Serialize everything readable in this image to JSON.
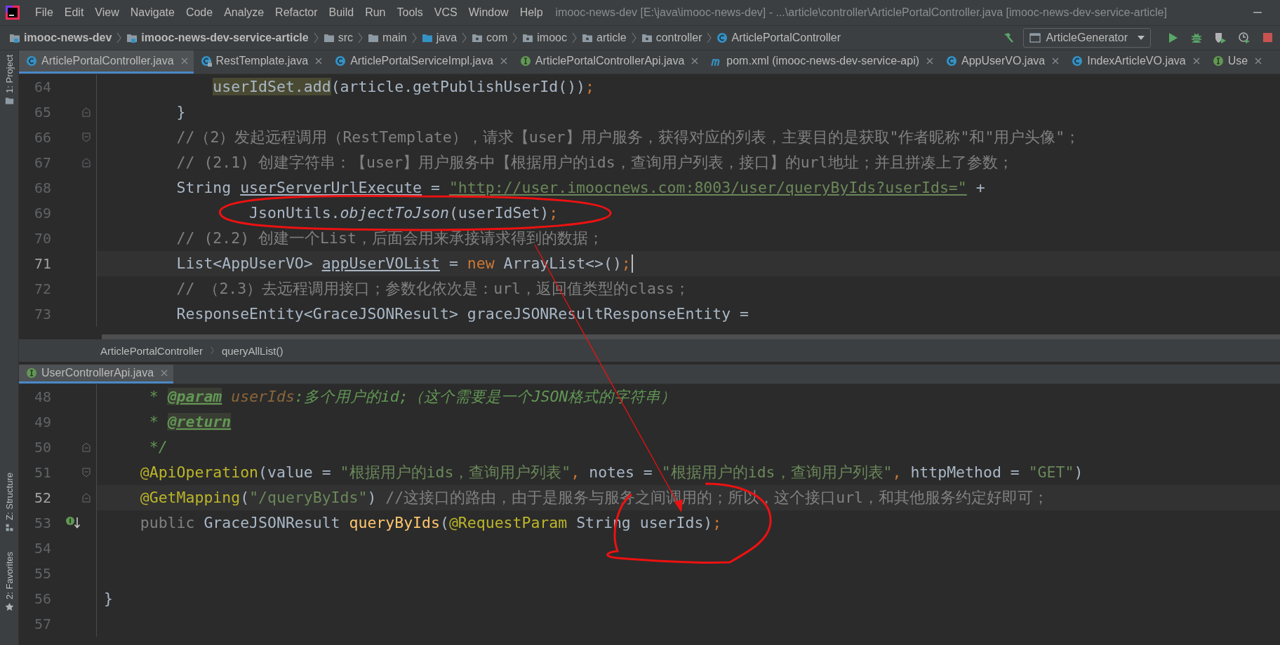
{
  "menu_bar": {
    "items": [
      "File",
      "Edit",
      "View",
      "Navigate",
      "Code",
      "Analyze",
      "Refactor",
      "Build",
      "Run",
      "Tools",
      "VCS",
      "Window",
      "Help"
    ],
    "title": "imooc-news-dev [E:\\java\\imooc-news-dev] - ...\\article\\controller\\ArticlePortalController.java [imooc-news-dev-service-article]"
  },
  "nav_bar": {
    "crumbs": [
      {
        "label": "imooc-news-dev",
        "kind": "module"
      },
      {
        "label": "imooc-news-dev-service-article",
        "kind": "module"
      },
      {
        "label": "src",
        "kind": "folder"
      },
      {
        "label": "main",
        "kind": "folder"
      },
      {
        "label": "java",
        "kind": "source"
      },
      {
        "label": "com",
        "kind": "package"
      },
      {
        "label": "imooc",
        "kind": "package"
      },
      {
        "label": "article",
        "kind": "package"
      },
      {
        "label": "controller",
        "kind": "package"
      },
      {
        "label": "ArticlePortalController",
        "kind": "class"
      }
    ],
    "run_config": "ArticleGenerator"
  },
  "side_strip": [
    {
      "label": "1: Project",
      "kind": "project"
    },
    {
      "label": "Z: Structure",
      "kind": "structure"
    },
    {
      "label": "2: Favorites",
      "kind": "favorites"
    }
  ],
  "editor_tabs": [
    {
      "label": "ArticlePortalController.java",
      "kind": "class",
      "selected": true,
      "locked": false
    },
    {
      "label": "RestTemplate.java",
      "kind": "class",
      "selected": false,
      "locked": true
    },
    {
      "label": "ArticlePortalServiceImpl.java",
      "kind": "class",
      "selected": false,
      "locked": false
    },
    {
      "label": "ArticlePortalControllerApi.java",
      "kind": "interface",
      "selected": false,
      "locked": false
    },
    {
      "label": "pom.xml (imooc-news-dev-service-api)",
      "kind": "maven",
      "selected": false,
      "locked": false
    },
    {
      "label": "AppUserVO.java",
      "kind": "class",
      "selected": false,
      "locked": false
    },
    {
      "label": "IndexArticleVO.java",
      "kind": "class",
      "selected": false,
      "locked": false
    },
    {
      "label": "Use",
      "kind": "interface",
      "selected": false,
      "locked": false
    }
  ],
  "top_editor": {
    "lines": [
      {
        "number": "64",
        "tokens": [
          {
            "text": "            userIdSet.add",
            "kind": "usage"
          },
          {
            "text": "(article.getPublishUserId())",
            "kind": "plain"
          },
          {
            "text": ";",
            "kind": "keyword"
          }
        ]
      },
      {
        "number": "65",
        "fold_close": true,
        "tokens": [
          {
            "text": "        }",
            "kind": "plain"
          }
        ]
      },
      {
        "number": "66",
        "fold_open": true,
        "tokens": [
          {
            "text": "        //（2）发起远程调用（RestTemplate），请求【user】用户服务，获得对应的列表，主要目的是获取\"作者昵称\"和\"用户头像\"；",
            "kind": "comment"
          }
        ]
      },
      {
        "number": "67",
        "fold_close": true,
        "tokens": [
          {
            "text": "        // (2.1) 创建字符串：【user】用户服务中【根据用户的ids，查询用户列表，接口】的url地址；并且拼凑上了参数；",
            "kind": "comment"
          }
        ]
      },
      {
        "number": "68",
        "tokens": [
          {
            "text": "        String ",
            "kind": "plain"
          },
          {
            "text": "userServerUrlExecute",
            "kind": "underlined"
          },
          {
            "text": " = ",
            "kind": "plain"
          },
          {
            "text": "\"http://user.imoocnews.com:8003/user/queryByIds?userIds=\"",
            "kind": "link"
          },
          {
            "text": " +",
            "kind": "plain"
          }
        ]
      },
      {
        "number": "69",
        "tokens": [
          {
            "text": "                JsonUtils.",
            "kind": "plain"
          },
          {
            "text": "objectToJson",
            "kind": "static"
          },
          {
            "text": "(userIdSet)",
            "kind": "plain"
          },
          {
            "text": ";",
            "kind": "keyword"
          }
        ]
      },
      {
        "number": "70",
        "tokens": [
          {
            "text": "        // (2.2) 创建一个List，后面会用来承接请求得到的数据；",
            "kind": "comment"
          }
        ]
      },
      {
        "number": "71",
        "current": true,
        "caret": true,
        "tokens": [
          {
            "text": "        List<AppUserVO> ",
            "kind": "plain"
          },
          {
            "text": "appUserVOList",
            "kind": "underlined"
          },
          {
            "text": " = ",
            "kind": "plain"
          },
          {
            "text": "new",
            "kind": "keyword"
          },
          {
            "text": " ArrayList<>()",
            "kind": "plain"
          },
          {
            "text": ";",
            "kind": "keyword"
          }
        ]
      },
      {
        "number": "72",
        "tokens": [
          {
            "text": "        // （2.3）去远程调用接口；参数化依次是：url，返回值类型的class；",
            "kind": "comment"
          }
        ]
      },
      {
        "number": "73",
        "tokens": [
          {
            "text": "        ResponseEntity<GraceJSONResult> graceJSONResultResponseEntity =",
            "kind": "plain"
          }
        ]
      }
    ],
    "breadcrumbs": [
      "ArticlePortalController",
      "queryAllList()"
    ]
  },
  "bottom_editor": {
    "tab": {
      "label": "UserControllerApi.java",
      "kind": "interface",
      "selected": true
    },
    "lines": [
      {
        "number": "48",
        "tokens": [
          {
            "text": "     * ",
            "kind": "doc"
          },
          {
            "text": "@param",
            "kind": "doctag"
          },
          {
            "text": " userIds",
            "kind": "docparam"
          },
          {
            "text": ":多个用户的id;（这个需要是一个JSON格式的字符串）",
            "kind": "doc"
          }
        ]
      },
      {
        "number": "49",
        "tokens": [
          {
            "text": "     * ",
            "kind": "doc"
          },
          {
            "text": "@return",
            "kind": "doctag"
          }
        ]
      },
      {
        "number": "50",
        "fold_close": true,
        "tokens": [
          {
            "text": "     */",
            "kind": "doc"
          }
        ]
      },
      {
        "number": "51",
        "fold_open": true,
        "tokens": [
          {
            "text": "    @ApiOperation",
            "kind": "annotation"
          },
          {
            "text": "(value = ",
            "kind": "plain"
          },
          {
            "text": "\"根据用户的ids，查询用户列表\"",
            "kind": "string"
          },
          {
            "text": ",",
            "kind": "keyword"
          },
          {
            "text": " notes = ",
            "kind": "plain"
          },
          {
            "text": "\"根据用户的ids，查询用户列表\"",
            "kind": "string"
          },
          {
            "text": ",",
            "kind": "keyword"
          },
          {
            "text": " httpMethod = ",
            "kind": "plain"
          },
          {
            "text": "\"GET\"",
            "kind": "string"
          },
          {
            "text": ")",
            "kind": "plain"
          }
        ]
      },
      {
        "number": "52",
        "fold_close": true,
        "current": true,
        "tokens": [
          {
            "text": "    @GetMapping",
            "kind": "annotation"
          },
          {
            "text": "(",
            "kind": "plain"
          },
          {
            "text": "\"/queryByIds\"",
            "kind": "string"
          },
          {
            "text": ") ",
            "kind": "plain"
          },
          {
            "text": "//这接口的路由，由于是服务与服务之间调用的；所以，这个接口url，和其他服务约定好即可；",
            "kind": "comment"
          }
        ]
      },
      {
        "number": "53",
        "implemented": true,
        "tokens": [
          {
            "text": "    public",
            "kind": "redundant"
          },
          {
            "text": " GraceJSONResult ",
            "kind": "plain"
          },
          {
            "text": "queryByIds",
            "kind": "method"
          },
          {
            "text": "(",
            "kind": "plain"
          },
          {
            "text": "@RequestParam",
            "kind": "annotation"
          },
          {
            "text": " String userIds)",
            "kind": "plain"
          },
          {
            "text": ";",
            "kind": "keyword"
          }
        ]
      },
      {
        "number": "54"
      },
      {
        "number": "55"
      },
      {
        "number": "56",
        "tokens": [
          {
            "text": "}",
            "kind": "plain"
          }
        ]
      },
      {
        "number": "57"
      }
    ]
  }
}
